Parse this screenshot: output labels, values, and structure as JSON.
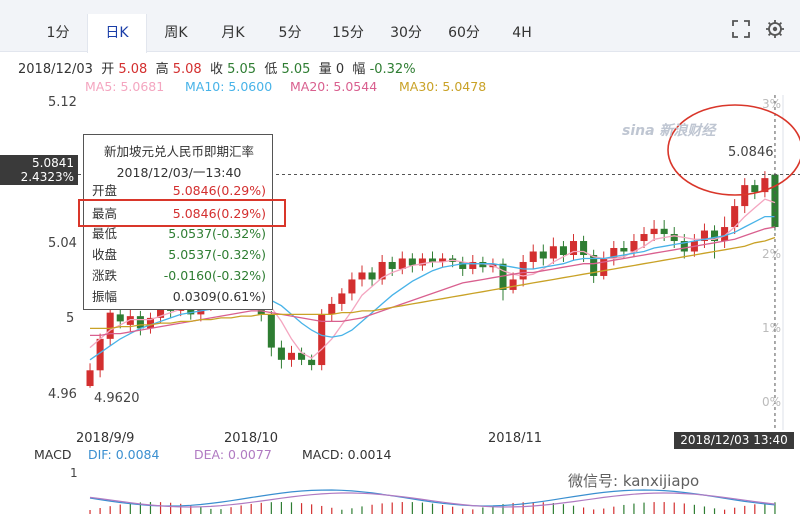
{
  "tabs": [
    {
      "label": "1分",
      "active": false
    },
    {
      "label": "日K",
      "active": true
    },
    {
      "label": "周K",
      "active": false
    },
    {
      "label": "月K",
      "active": false
    },
    {
      "label": "5分",
      "active": false
    },
    {
      "label": "15分",
      "active": false
    },
    {
      "label": "30分",
      "active": false
    },
    {
      "label": "60分",
      "active": false
    },
    {
      "label": "4H",
      "active": false
    }
  ],
  "icons": {
    "fullscreen": "fullscreen-icon",
    "settings": "settings-icon"
  },
  "info": {
    "date": "2018/12/03",
    "open_label": "开",
    "open_value": "5.08",
    "high_label": "高",
    "high_value": "5.08",
    "close_label": "收",
    "close_value": "5.05",
    "low_label": "低",
    "low_value": "5.05",
    "vol_label": "量",
    "vol_value": "0",
    "amp_label": "幅",
    "amp_value": "-0.32%"
  },
  "ma": [
    {
      "text": "MA5: 5.0681",
      "color": "#f4a6c0"
    },
    {
      "text": "MA10: 5.0600",
      "color": "#48b3e8"
    },
    {
      "text": "MA20: 5.0544",
      "color": "#d9608f"
    },
    {
      "text": "MA30: 5.0478",
      "color": "#c9a227"
    }
  ],
  "chart_data": {
    "type": "candlestick",
    "y_ticks": [
      "5.12",
      "5.04",
      "5",
      "4.96"
    ],
    "pct_ticks": [
      "3%",
      "2%",
      "1%",
      "0%"
    ],
    "x_ticks": [
      "2018/9/9",
      "2018/10",
      "2018/11"
    ],
    "ylim": [
      4.955,
      5.125
    ],
    "last_price_label": "5.0846",
    "low_label": "4.9620",
    "crosshair_price": "5.0841",
    "crosshair_pct": "2.4323%",
    "crosshair_date": "2018/12/03 13:40",
    "watermark": "sina 新浪财经",
    "candles": [
      {
        "o": 4.963,
        "c": 4.972,
        "h": 4.976,
        "l": 4.962
      },
      {
        "o": 4.972,
        "c": 4.99,
        "h": 4.993,
        "l": 4.968
      },
      {
        "o": 4.99,
        "c": 5.005,
        "h": 5.008,
        "l": 4.986
      },
      {
        "o": 5.004,
        "c": 5.0,
        "h": 5.01,
        "l": 4.996
      },
      {
        "o": 4.998,
        "c": 5.003,
        "h": 5.007,
        "l": 4.994
      },
      {
        "o": 5.003,
        "c": 4.996,
        "h": 5.006,
        "l": 4.992
      },
      {
        "o": 4.996,
        "c": 5.002,
        "h": 5.005,
        "l": 4.993
      },
      {
        "o": 5.002,
        "c": 5.01,
        "h": 5.014,
        "l": 4.999
      },
      {
        "o": 5.01,
        "c": 5.006,
        "h": 5.013,
        "l": 5.002
      },
      {
        "o": 5.006,
        "c": 5.012,
        "h": 5.016,
        "l": 5.003
      },
      {
        "o": 5.012,
        "c": 5.004,
        "h": 5.015,
        "l": 5.001
      },
      {
        "o": 5.004,
        "c": 5.01,
        "h": 5.013,
        "l": 5.0
      },
      {
        "o": 5.01,
        "c": 5.018,
        "h": 5.021,
        "l": 5.006
      },
      {
        "o": 5.018,
        "c": 5.012,
        "h": 5.022,
        "l": 5.009
      },
      {
        "o": 5.012,
        "c": 5.02,
        "h": 5.024,
        "l": 5.008
      },
      {
        "o": 5.02,
        "c": 5.026,
        "h": 5.03,
        "l": 5.016
      },
      {
        "o": 5.026,
        "c": 5.016,
        "h": 5.029,
        "l": 5.012
      },
      {
        "o": 5.016,
        "c": 5.004,
        "h": 5.019,
        "l": 5.0
      },
      {
        "o": 5.004,
        "c": 4.985,
        "h": 5.006,
        "l": 4.98
      },
      {
        "o": 4.985,
        "c": 4.978,
        "h": 4.989,
        "l": 4.973
      },
      {
        "o": 4.978,
        "c": 4.982,
        "h": 4.986,
        "l": 4.974
      },
      {
        "o": 4.982,
        "c": 4.978,
        "h": 4.985,
        "l": 4.975
      },
      {
        "o": 4.978,
        "c": 4.975,
        "h": 4.981,
        "l": 4.972
      },
      {
        "o": 4.975,
        "c": 5.004,
        "h": 5.007,
        "l": 4.972
      },
      {
        "o": 5.004,
        "c": 5.01,
        "h": 5.014,
        "l": 5.0
      },
      {
        "o": 5.01,
        "c": 5.016,
        "h": 5.019,
        "l": 5.006
      },
      {
        "o": 5.016,
        "c": 5.024,
        "h": 5.028,
        "l": 5.012
      },
      {
        "o": 5.024,
        "c": 5.028,
        "h": 5.032,
        "l": 5.02
      },
      {
        "o": 5.028,
        "c": 5.024,
        "h": 5.031,
        "l": 5.02
      },
      {
        "o": 5.024,
        "c": 5.034,
        "h": 5.038,
        "l": 5.021
      },
      {
        "o": 5.034,
        "c": 5.03,
        "h": 5.037,
        "l": 5.026
      },
      {
        "o": 5.03,
        "c": 5.036,
        "h": 5.04,
        "l": 5.027
      },
      {
        "o": 5.036,
        "c": 5.032,
        "h": 5.039,
        "l": 5.028
      },
      {
        "o": 5.032,
        "c": 5.036,
        "h": 5.039,
        "l": 5.029
      },
      {
        "o": 5.036,
        "c": 5.034,
        "h": 5.04,
        "l": 5.031
      },
      {
        "o": 5.034,
        "c": 5.036,
        "h": 5.039,
        "l": 5.031
      },
      {
        "o": 5.036,
        "c": 5.034,
        "h": 5.038,
        "l": 5.031
      },
      {
        "o": 5.034,
        "c": 5.03,
        "h": 5.037,
        "l": 5.026
      },
      {
        "o": 5.03,
        "c": 5.034,
        "h": 5.038,
        "l": 5.027
      },
      {
        "o": 5.034,
        "c": 5.031,
        "h": 5.037,
        "l": 5.028
      },
      {
        "o": 5.031,
        "c": 5.033,
        "h": 5.036,
        "l": 5.028
      },
      {
        "o": 5.033,
        "c": 5.018,
        "h": 5.036,
        "l": 5.012
      },
      {
        "o": 5.018,
        "c": 5.024,
        "h": 5.028,
        "l": 5.016
      },
      {
        "o": 5.024,
        "c": 5.034,
        "h": 5.038,
        "l": 5.02
      },
      {
        "o": 5.034,
        "c": 5.04,
        "h": 5.044,
        "l": 5.03
      },
      {
        "o": 5.04,
        "c": 5.036,
        "h": 5.044,
        "l": 5.032
      },
      {
        "o": 5.036,
        "c": 5.043,
        "h": 5.048,
        "l": 5.033
      },
      {
        "o": 5.043,
        "c": 5.038,
        "h": 5.046,
        "l": 5.034
      },
      {
        "o": 5.038,
        "c": 5.046,
        "h": 5.05,
        "l": 5.035
      },
      {
        "o": 5.046,
        "c": 5.038,
        "h": 5.049,
        "l": 5.034
      },
      {
        "o": 5.038,
        "c": 5.026,
        "h": 5.041,
        "l": 5.022
      },
      {
        "o": 5.026,
        "c": 5.036,
        "h": 5.04,
        "l": 5.024
      },
      {
        "o": 5.036,
        "c": 5.042,
        "h": 5.046,
        "l": 5.032
      },
      {
        "o": 5.042,
        "c": 5.04,
        "h": 5.046,
        "l": 5.036
      },
      {
        "o": 5.04,
        "c": 5.046,
        "h": 5.05,
        "l": 5.037
      },
      {
        "o": 5.046,
        "c": 5.05,
        "h": 5.054,
        "l": 5.042
      },
      {
        "o": 5.05,
        "c": 5.053,
        "h": 5.058,
        "l": 5.046
      },
      {
        "o": 5.053,
        "c": 5.05,
        "h": 5.058,
        "l": 5.046
      },
      {
        "o": 5.05,
        "c": 5.046,
        "h": 5.054,
        "l": 5.042
      },
      {
        "o": 5.046,
        "c": 5.04,
        "h": 5.05,
        "l": 5.036
      },
      {
        "o": 5.04,
        "c": 5.046,
        "h": 5.05,
        "l": 5.037
      },
      {
        "o": 5.046,
        "c": 5.052,
        "h": 5.056,
        "l": 5.042
      },
      {
        "o": 5.052,
        "c": 5.046,
        "h": 5.055,
        "l": 5.036
      },
      {
        "o": 5.046,
        "c": 5.054,
        "h": 5.06,
        "l": 5.042
      },
      {
        "o": 5.054,
        "c": 5.066,
        "h": 5.07,
        "l": 5.05
      },
      {
        "o": 5.066,
        "c": 5.078,
        "h": 5.082,
        "l": 5.062
      },
      {
        "o": 5.078,
        "c": 5.074,
        "h": 5.081,
        "l": 5.07
      },
      {
        "o": 5.074,
        "c": 5.082,
        "h": 5.086,
        "l": 5.071
      },
      {
        "o": 5.084,
        "c": 5.054,
        "h": 5.085,
        "l": 5.052
      }
    ],
    "ma_lines": [
      {
        "name": "MA5",
        "color": "#f4a6c0",
        "values": [
          4.985,
          4.99,
          4.995,
          4.998,
          5.001,
          5.001,
          5.001,
          5.003,
          5.005,
          5.007,
          5.008,
          5.008,
          5.01,
          5.012,
          5.014,
          5.017,
          5.017,
          5.014,
          5.008,
          5.0,
          4.99,
          4.982,
          4.979,
          4.984,
          4.99,
          4.998,
          5.006,
          5.015,
          5.02,
          5.025,
          5.028,
          5.03,
          5.032,
          5.033,
          5.034,
          5.034,
          5.035,
          5.034,
          5.033,
          5.033,
          5.032,
          5.029,
          5.027,
          5.026,
          5.027,
          5.03,
          5.034,
          5.037,
          5.04,
          5.04,
          5.037,
          5.036,
          5.036,
          5.037,
          5.04,
          5.043,
          5.047,
          5.048,
          5.049,
          5.048,
          5.047,
          5.047,
          5.047,
          5.049,
          5.054,
          5.06,
          5.065,
          5.07,
          5.068
        ]
      },
      {
        "name": "MA10",
        "color": "#48b3e8",
        "values": [
          4.978,
          4.982,
          4.986,
          4.99,
          4.993,
          4.996,
          4.998,
          5.0,
          5.002,
          5.004,
          5.005,
          5.006,
          5.007,
          5.009,
          5.011,
          5.013,
          5.014,
          5.014,
          5.012,
          5.009,
          5.004,
          4.999,
          4.995,
          4.992,
          4.991,
          4.992,
          4.995,
          5.0,
          5.005,
          5.01,
          5.015,
          5.019,
          5.023,
          5.026,
          5.029,
          5.031,
          5.032,
          5.033,
          5.033,
          5.033,
          5.033,
          5.032,
          5.031,
          5.03,
          5.03,
          5.031,
          5.032,
          5.033,
          5.035,
          5.036,
          5.036,
          5.036,
          5.037,
          5.038,
          5.039,
          5.04,
          5.042,
          5.043,
          5.044,
          5.045,
          5.046,
          5.047,
          5.048,
          5.049,
          5.051,
          5.054,
          5.057,
          5.06,
          5.06
        ]
      },
      {
        "name": "MA20",
        "color": "#d9608f",
        "values": [
          4.992,
          4.992,
          4.993,
          4.993,
          4.994,
          4.995,
          4.996,
          4.997,
          4.998,
          4.999,
          5.0,
          5.001,
          5.002,
          5.003,
          5.004,
          5.005,
          5.006,
          5.006,
          5.005,
          5.004,
          5.003,
          5.002,
          5.001,
          5.0,
          5.0,
          5.0,
          5.001,
          5.002,
          5.004,
          5.006,
          5.008,
          5.01,
          5.012,
          5.014,
          5.016,
          5.018,
          5.02,
          5.022,
          5.023,
          5.024,
          5.025,
          5.026,
          5.027,
          5.028,
          5.028,
          5.029,
          5.03,
          5.031,
          5.032,
          5.033,
          5.033,
          5.034,
          5.035,
          5.036,
          5.037,
          5.038,
          5.039,
          5.04,
          5.041,
          5.042,
          5.043,
          5.044,
          5.045,
          5.046,
          5.047,
          5.049,
          5.051,
          5.053,
          5.054
        ]
      },
      {
        "name": "MA30",
        "color": "#c9a227",
        "values": [
          4.996,
          4.996,
          4.996,
          4.997,
          4.997,
          4.998,
          4.998,
          4.999,
          4.999,
          5.0,
          5.0,
          5.001,
          5.001,
          5.002,
          5.002,
          5.003,
          5.003,
          5.004,
          5.004,
          5.004,
          5.004,
          5.004,
          5.004,
          5.004,
          5.004,
          5.005,
          5.005,
          5.006,
          5.006,
          5.007,
          5.008,
          5.009,
          5.01,
          5.011,
          5.012,
          5.013,
          5.014,
          5.015,
          5.016,
          5.017,
          5.018,
          5.019,
          5.02,
          5.021,
          5.022,
          5.023,
          5.024,
          5.025,
          5.026,
          5.027,
          5.028,
          5.029,
          5.03,
          5.031,
          5.032,
          5.033,
          5.034,
          5.035,
          5.036,
          5.037,
          5.038,
          5.039,
          5.04,
          5.041,
          5.042,
          5.043,
          5.045,
          5.046,
          5.048
        ]
      }
    ]
  },
  "tooltip": {
    "name": "新加坡元兑人民币即期汇率",
    "time": "2018/12/03/一13:40",
    "rows": [
      {
        "label": "开盘",
        "value": "5.0846(0.29%)",
        "color": "red"
      },
      {
        "label": "最高",
        "value": "5.0846(0.29%)",
        "color": "red"
      },
      {
        "label": "最低",
        "value": "5.0537(-0.32%)",
        "color": "green"
      },
      {
        "label": "收盘",
        "value": "5.0537(-0.32%)",
        "color": "green"
      },
      {
        "label": "涨跌",
        "value": "-0.0160(-0.32%)",
        "color": "green"
      },
      {
        "label": "振幅",
        "value": "0.0309(0.61%)",
        "color": "dark"
      }
    ]
  },
  "macd": {
    "title": "MACD",
    "dif": "DIF: 0.0084",
    "dea": "DEA: 0.0077",
    "macd": "MACD: 0.0014",
    "dif_color": "#3a8fd0",
    "dea_color": "#b07ac2",
    "macd_color": "#333333",
    "scale": "1"
  },
  "wechat": "微信号: kanxijiapo"
}
